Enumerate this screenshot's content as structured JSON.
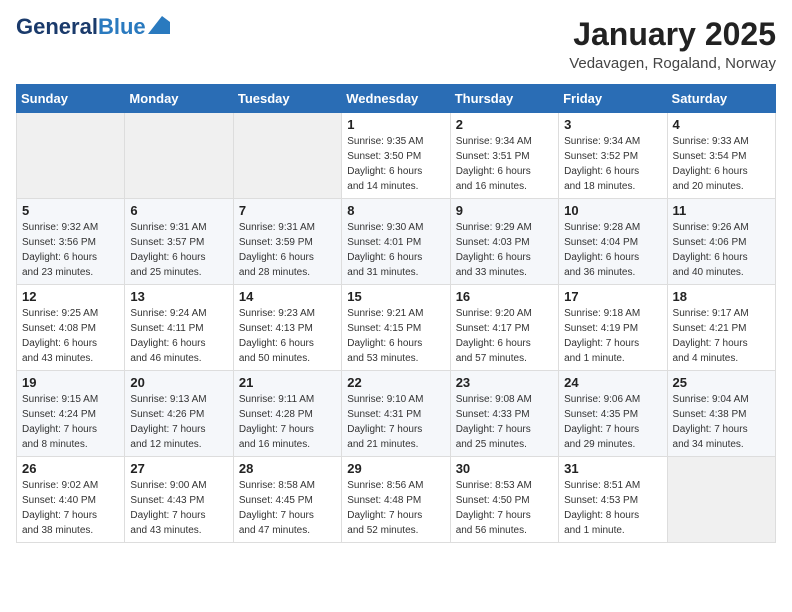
{
  "logo": {
    "part1": "General",
    "part2": "Blue"
  },
  "header": {
    "month": "January 2025",
    "location": "Vedavagen, Rogaland, Norway"
  },
  "weekdays": [
    "Sunday",
    "Monday",
    "Tuesday",
    "Wednesday",
    "Thursday",
    "Friday",
    "Saturday"
  ],
  "weeks": [
    [
      {
        "day": "",
        "info": ""
      },
      {
        "day": "",
        "info": ""
      },
      {
        "day": "",
        "info": ""
      },
      {
        "day": "1",
        "info": "Sunrise: 9:35 AM\nSunset: 3:50 PM\nDaylight: 6 hours\nand 14 minutes."
      },
      {
        "day": "2",
        "info": "Sunrise: 9:34 AM\nSunset: 3:51 PM\nDaylight: 6 hours\nand 16 minutes."
      },
      {
        "day": "3",
        "info": "Sunrise: 9:34 AM\nSunset: 3:52 PM\nDaylight: 6 hours\nand 18 minutes."
      },
      {
        "day": "4",
        "info": "Sunrise: 9:33 AM\nSunset: 3:54 PM\nDaylight: 6 hours\nand 20 minutes."
      }
    ],
    [
      {
        "day": "5",
        "info": "Sunrise: 9:32 AM\nSunset: 3:56 PM\nDaylight: 6 hours\nand 23 minutes."
      },
      {
        "day": "6",
        "info": "Sunrise: 9:31 AM\nSunset: 3:57 PM\nDaylight: 6 hours\nand 25 minutes."
      },
      {
        "day": "7",
        "info": "Sunrise: 9:31 AM\nSunset: 3:59 PM\nDaylight: 6 hours\nand 28 minutes."
      },
      {
        "day": "8",
        "info": "Sunrise: 9:30 AM\nSunset: 4:01 PM\nDaylight: 6 hours\nand 31 minutes."
      },
      {
        "day": "9",
        "info": "Sunrise: 9:29 AM\nSunset: 4:03 PM\nDaylight: 6 hours\nand 33 minutes."
      },
      {
        "day": "10",
        "info": "Sunrise: 9:28 AM\nSunset: 4:04 PM\nDaylight: 6 hours\nand 36 minutes."
      },
      {
        "day": "11",
        "info": "Sunrise: 9:26 AM\nSunset: 4:06 PM\nDaylight: 6 hours\nand 40 minutes."
      }
    ],
    [
      {
        "day": "12",
        "info": "Sunrise: 9:25 AM\nSunset: 4:08 PM\nDaylight: 6 hours\nand 43 minutes."
      },
      {
        "day": "13",
        "info": "Sunrise: 9:24 AM\nSunset: 4:11 PM\nDaylight: 6 hours\nand 46 minutes."
      },
      {
        "day": "14",
        "info": "Sunrise: 9:23 AM\nSunset: 4:13 PM\nDaylight: 6 hours\nand 50 minutes."
      },
      {
        "day": "15",
        "info": "Sunrise: 9:21 AM\nSunset: 4:15 PM\nDaylight: 6 hours\nand 53 minutes."
      },
      {
        "day": "16",
        "info": "Sunrise: 9:20 AM\nSunset: 4:17 PM\nDaylight: 6 hours\nand 57 minutes."
      },
      {
        "day": "17",
        "info": "Sunrise: 9:18 AM\nSunset: 4:19 PM\nDaylight: 7 hours\nand 1 minute."
      },
      {
        "day": "18",
        "info": "Sunrise: 9:17 AM\nSunset: 4:21 PM\nDaylight: 7 hours\nand 4 minutes."
      }
    ],
    [
      {
        "day": "19",
        "info": "Sunrise: 9:15 AM\nSunset: 4:24 PM\nDaylight: 7 hours\nand 8 minutes."
      },
      {
        "day": "20",
        "info": "Sunrise: 9:13 AM\nSunset: 4:26 PM\nDaylight: 7 hours\nand 12 minutes."
      },
      {
        "day": "21",
        "info": "Sunrise: 9:11 AM\nSunset: 4:28 PM\nDaylight: 7 hours\nand 16 minutes."
      },
      {
        "day": "22",
        "info": "Sunrise: 9:10 AM\nSunset: 4:31 PM\nDaylight: 7 hours\nand 21 minutes."
      },
      {
        "day": "23",
        "info": "Sunrise: 9:08 AM\nSunset: 4:33 PM\nDaylight: 7 hours\nand 25 minutes."
      },
      {
        "day": "24",
        "info": "Sunrise: 9:06 AM\nSunset: 4:35 PM\nDaylight: 7 hours\nand 29 minutes."
      },
      {
        "day": "25",
        "info": "Sunrise: 9:04 AM\nSunset: 4:38 PM\nDaylight: 7 hours\nand 34 minutes."
      }
    ],
    [
      {
        "day": "26",
        "info": "Sunrise: 9:02 AM\nSunset: 4:40 PM\nDaylight: 7 hours\nand 38 minutes."
      },
      {
        "day": "27",
        "info": "Sunrise: 9:00 AM\nSunset: 4:43 PM\nDaylight: 7 hours\nand 43 minutes."
      },
      {
        "day": "28",
        "info": "Sunrise: 8:58 AM\nSunset: 4:45 PM\nDaylight: 7 hours\nand 47 minutes."
      },
      {
        "day": "29",
        "info": "Sunrise: 8:56 AM\nSunset: 4:48 PM\nDaylight: 7 hours\nand 52 minutes."
      },
      {
        "day": "30",
        "info": "Sunrise: 8:53 AM\nSunset: 4:50 PM\nDaylight: 7 hours\nand 56 minutes."
      },
      {
        "day": "31",
        "info": "Sunrise: 8:51 AM\nSunset: 4:53 PM\nDaylight: 8 hours\nand 1 minute."
      },
      {
        "day": "",
        "info": ""
      }
    ]
  ]
}
